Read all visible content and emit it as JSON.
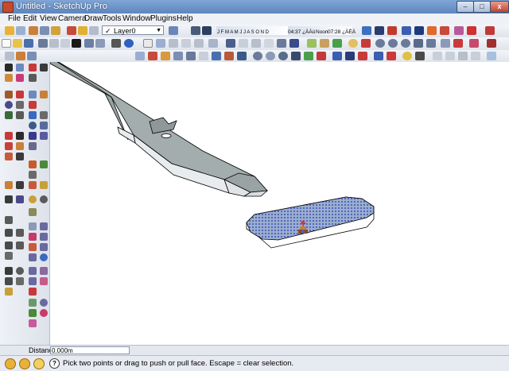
{
  "window": {
    "title": "Untitled - SketchUp Pro",
    "min_label": "–",
    "max_label": "□",
    "close_label": "x"
  },
  "menu": [
    "File",
    "Edit",
    "View",
    "Camera",
    "Draw",
    "Tools",
    "Window",
    "Plugins",
    "Help"
  ],
  "layer": {
    "current": "Layer0",
    "check": "✓",
    "arrow": "▼"
  },
  "shadow": {
    "months": "J F M A M J J A S O N D",
    "time_left": "04:37 ¿ÀÀü",
    "noon": "Noon",
    "time_right": "07:28 ¿ÀÈÄ"
  },
  "measurements": {
    "label": "Distance",
    "value": "0.000m"
  },
  "status": {
    "help_glyph": "?",
    "message": "Pick two points or drag to push or pull face.  Escape = clear selection."
  },
  "colors": {
    "face_front": "#ffffff",
    "face_back": "#9aaed1",
    "selection": "#2233aa",
    "edge": "#000000"
  }
}
